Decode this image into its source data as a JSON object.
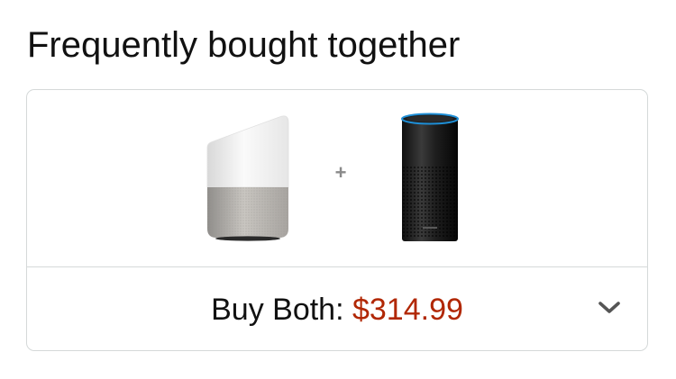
{
  "section": {
    "title": "Frequently bought together"
  },
  "bundle": {
    "products": [
      {
        "icon": "google-home-speaker-image"
      },
      {
        "icon": "amazon-echo-speaker-image"
      }
    ],
    "plus_symbol": "+",
    "buy_label": "Buy Both:",
    "buy_price": "$314.99",
    "price_color": "#b12704",
    "expand_icon": "chevron-down-icon"
  }
}
